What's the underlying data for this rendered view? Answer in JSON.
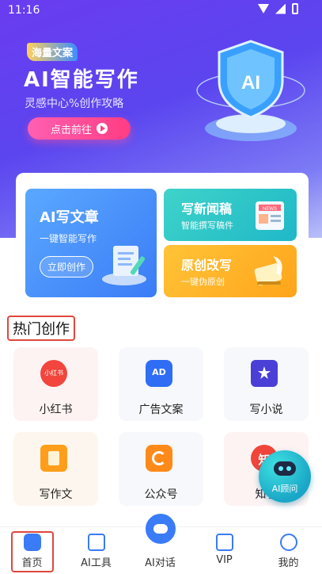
{
  "status": {
    "time": "11:16"
  },
  "hero": {
    "tag": "海量文案",
    "title": "AI智能写作",
    "subtitle": "灵感中心%创作攻略",
    "cta": "点击前往",
    "shield_text": "AI"
  },
  "feature_cards": {
    "write_article": {
      "title": "AI写文章",
      "subtitle": "一键智能写作",
      "button": "立即创作"
    },
    "news": {
      "title": "写新闻稿",
      "subtitle": "智能撰写稿件",
      "badge": "NEWS"
    },
    "original": {
      "title": "原创改写",
      "subtitle": "一键伪原创"
    }
  },
  "section": {
    "title": "热门创作"
  },
  "tiles": [
    {
      "label": "小红书",
      "icon_text": "小红书",
      "icon": "xiaohongshu-icon",
      "color": "#f2453d"
    },
    {
      "label": "广告文案",
      "icon_text": "AD",
      "icon": "ad-icon",
      "color": "#2f6df5"
    },
    {
      "label": "写小说",
      "icon": "novel-book-icon",
      "color": "#4a3fd6"
    },
    {
      "label": "写作文",
      "icon": "essay-document-icon",
      "color": "#ff9e1a"
    },
    {
      "label": "公众号",
      "icon": "official-account-icon",
      "color": "#ff8a1a"
    },
    {
      "label": "知乎",
      "icon_text": "知",
      "icon": "zhihu-icon",
      "color": "#f0453a"
    }
  ],
  "float_button": {
    "label": "AI顾问",
    "icon": "robot-icon"
  },
  "tabbar": [
    {
      "label": "首页",
      "icon": "home-icon"
    },
    {
      "label": "AI工具",
      "icon": "toolbox-icon"
    },
    {
      "label": "AI对话",
      "icon": "robot-icon"
    },
    {
      "label": "VIP",
      "icon": "vip-bookmark-icon"
    },
    {
      "label": "我的",
      "icon": "user-icon"
    }
  ],
  "colors": {
    "accent": "#5b45ef",
    "highlight": "#e0473d",
    "pink_cta": "#ff3d83"
  }
}
